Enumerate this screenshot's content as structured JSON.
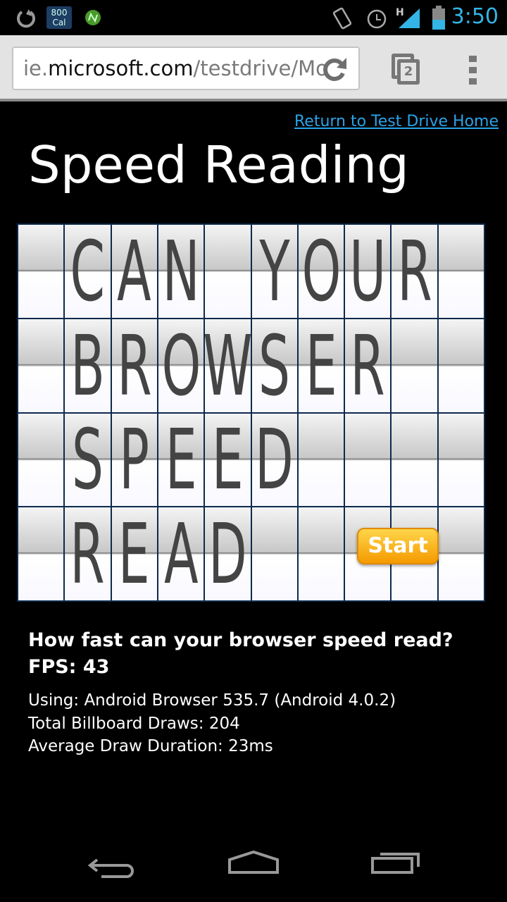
{
  "status_bar": {
    "time": "3:50",
    "cal_badge_top": "800",
    "cal_badge_bottom": "Cal",
    "icons": [
      "sync-icon",
      "calorie-app-icon",
      "app-n-icon",
      "rotate-icon",
      "alarm-icon",
      "signal-h-icon",
      "battery-icon"
    ]
  },
  "browser": {
    "url_prefix": "ie.",
    "url_domain": "microsoft.com",
    "url_path": "/testdrive/Mo",
    "tab_count": "2"
  },
  "page": {
    "return_link": "Return to Test Drive Home",
    "title": "Speed Reading",
    "board": [
      [
        "",
        " C",
        "A",
        "N",
        "",
        "Y",
        "O",
        "U",
        "R",
        ""
      ],
      [
        "",
        "B",
        "R",
        "O",
        "W",
        "S",
        "E",
        "R",
        "",
        ""
      ],
      [
        "",
        "S",
        "P",
        "E",
        "E",
        "D",
        "",
        "",
        "",
        ""
      ],
      [
        "",
        "R",
        "E",
        "A",
        "D",
        "",
        "",
        "",
        "",
        ""
      ]
    ],
    "start_label": "Start",
    "question": "How fast can your browser speed read?",
    "fps": "FPS: 43",
    "using": "Using: Android Browser 535.7 (Android 4.0.2)",
    "draws": "Total Billboard Draws: 204",
    "duration": "Average Draw Duration: 23ms"
  },
  "colors": {
    "accent": "#33b5e5",
    "link": "#2aa3e8",
    "start": "#f5a300"
  }
}
